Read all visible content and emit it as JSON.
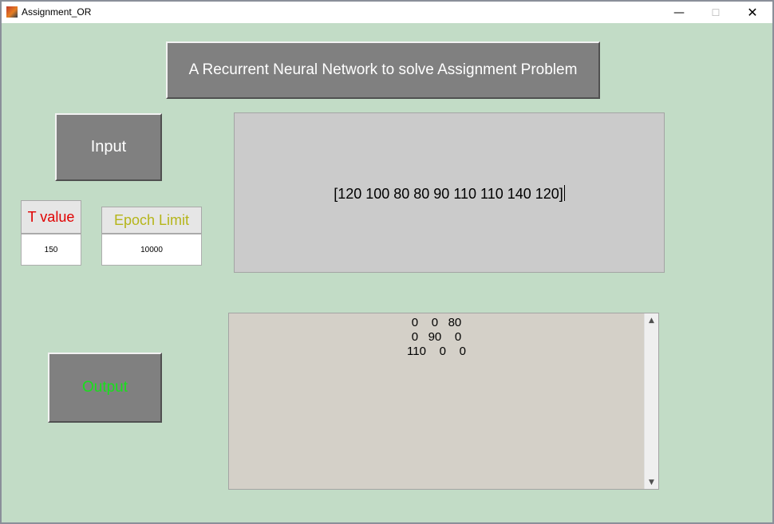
{
  "window": {
    "title": "Assignment_OR",
    "icon": "matlab-icon",
    "controls": {
      "minimize": "—",
      "maximize": "☐",
      "close": "✕"
    }
  },
  "main": {
    "title_button": "A Recurrent Neural Network to solve Assignment Problem",
    "input_button": "Input",
    "output_button": "Output",
    "t_value_label": "T value",
    "t_value": "150",
    "epoch_label": "Epoch Limit",
    "epoch_value": "10000",
    "input_text": "[120 100 80 80 90 110 110 140 120]",
    "output_lines": [
      "0    0   80",
      "0   90    0",
      "110    0    0"
    ]
  },
  "scrollbar": {
    "up_arrow": "▲",
    "down_arrow": "▼"
  },
  "colors": {
    "background": "#c2dcc6",
    "button_gray": "#808080",
    "t_value_label": "#e00000",
    "epoch_label": "#b5b51a",
    "output_label": "#16e21a"
  }
}
